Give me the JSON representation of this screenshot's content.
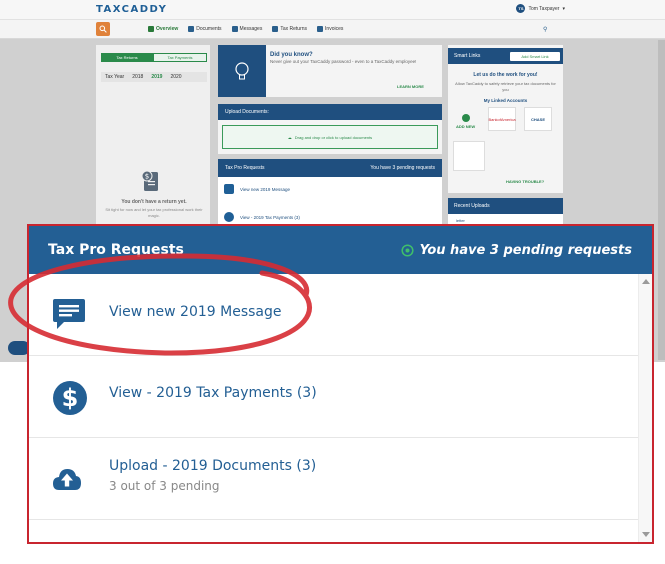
{
  "background": {
    "logo": "TAXCADDY",
    "user_initials": "TS",
    "user_name": "Tom Taxpayer",
    "nav": [
      "Overview",
      "Documents",
      "Messages",
      "Tax Returns",
      "Invoices"
    ],
    "toggle": {
      "on": "Tax Returns",
      "off": "Tax Payments"
    },
    "years": {
      "label": "Tax Year",
      "items": [
        "2018",
        "2019",
        "2020"
      ],
      "selected": "2019"
    },
    "no_return_title": "You don't have a return yet.",
    "no_return_sub": "Sit tight for now and let your tax professional work their magic.",
    "did_you_know": {
      "title": "Did you know?",
      "text": "Never give out your TaxCaddy password - even to a TaxCaddy employee!",
      "link": "LEARN MORE"
    },
    "upload": {
      "title": "Upload Documents:",
      "drop_text": "Drag and drop or click to upload documents"
    },
    "tax_pro_small": {
      "title": "Tax Pro Requests",
      "pending": "You have 3 pending requests",
      "items": [
        "View new 2019 Message",
        "View - 2019 Tax Payments (3)"
      ]
    },
    "smart_links": {
      "title": "Smart Links",
      "add": "Add Smart Link",
      "line1": "Let us do the work for you!",
      "line2": "Allow TaxCaddy to safely retrieve your tax documents for you",
      "linked": "My Linked Accounts",
      "add_new": "ADD NEW",
      "banks": [
        "BankofAmerica",
        "CHASE"
      ],
      "trouble": "HAVING TROUBLE?"
    },
    "recent_uploads": {
      "title": "Recent Uploads",
      "item": "letter"
    }
  },
  "popup": {
    "title": "Tax Pro Requests",
    "pending": "You have 3 pending requests",
    "items": [
      {
        "label": "View new 2019 Message",
        "sub": "",
        "icon": "message-icon"
      },
      {
        "label": "View - 2019 Tax Payments (3)",
        "sub": "",
        "icon": "dollar-icon"
      },
      {
        "label": "Upload - 2019 Documents (3)",
        "sub": "3 out of 3 pending",
        "icon": "cloud-upload-icon"
      }
    ]
  },
  "colors": {
    "header_blue": "#235f94",
    "green": "#2a8a4a",
    "highlight_red": "#c8252f",
    "popup_border": "#c8252f"
  }
}
